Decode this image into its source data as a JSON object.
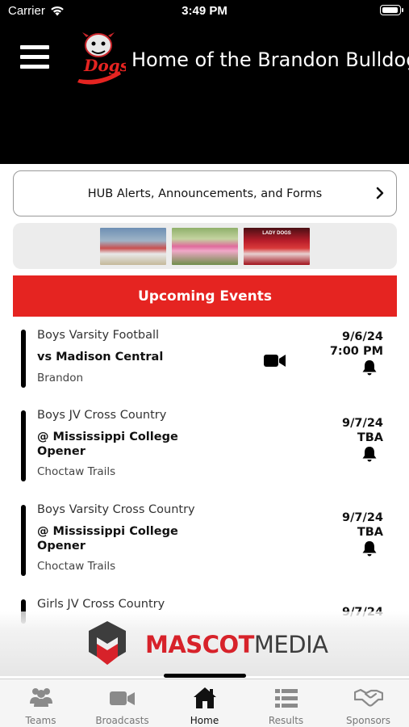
{
  "status_bar": {
    "carrier": "Carrier",
    "time": "3:49 PM"
  },
  "header": {
    "title": "Home of the Brandon Bulldogs",
    "logo_text": "Dogs",
    "icons": [
      "menu-icon",
      "bulldog-logo"
    ]
  },
  "alerts": {
    "label": "HUB Alerts, Announcements, and Forms"
  },
  "photo_strip": {
    "photo_3_text": "LADY DOGS"
  },
  "events_section": {
    "title": "Upcoming Events",
    "accent_color": "#e52421"
  },
  "events": [
    {
      "sport": "Boys Varsity Football",
      "opponent": "vs Madison Central",
      "location": "Brandon",
      "date": "9/6/24",
      "time": "7:00 PM",
      "broadcast": true
    },
    {
      "sport": "Boys JV Cross Country",
      "opponent": "@ Mississippi College Opener",
      "location": "Choctaw Trails",
      "date": "9/7/24",
      "time": "TBA",
      "broadcast": false
    },
    {
      "sport": "Boys Varsity Cross Country",
      "opponent": "@ Mississippi College Opener",
      "location": "Choctaw Trails",
      "date": "9/7/24",
      "time": "TBA",
      "broadcast": false
    },
    {
      "sport": "Girls JV Cross Country",
      "date": "9/7/24"
    }
  ],
  "sponsor": {
    "name_part1": "MASCOT",
    "name_part2": "MEDIA",
    "brand_red": "#d7222a"
  },
  "tabbar": {
    "tabs": [
      {
        "label": "Teams",
        "icon": "people-icon"
      },
      {
        "label": "Broadcasts",
        "icon": "video-camera-icon"
      },
      {
        "label": "Home",
        "icon": "home-icon",
        "active": true
      },
      {
        "label": "Results",
        "icon": "list-icon"
      },
      {
        "label": "Sponsors",
        "icon": "handshake-icon"
      }
    ]
  }
}
